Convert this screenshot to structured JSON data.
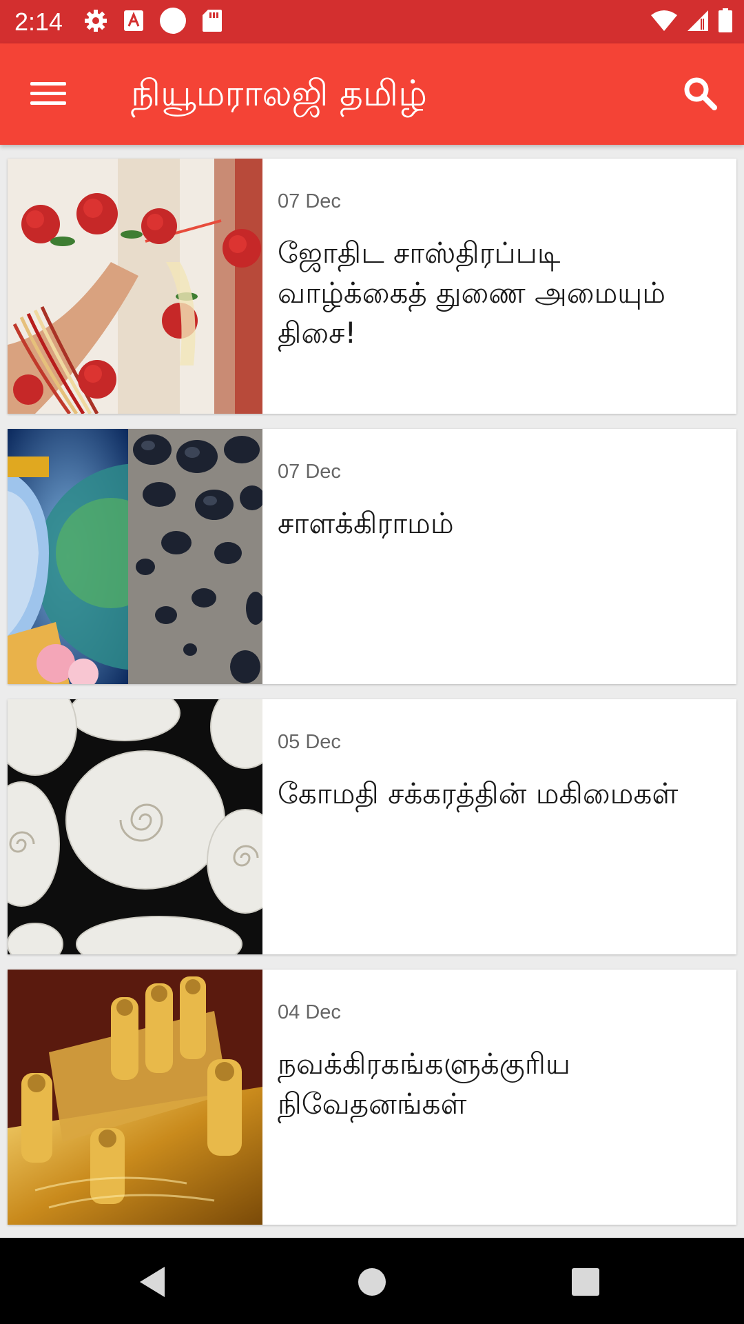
{
  "status_bar": {
    "time": "2:14",
    "icons": [
      "settings-icon",
      "app-notification-icon",
      "circle-notification-icon",
      "sd-card-icon",
      "wifi-icon",
      "signal-icon",
      "battery-icon"
    ]
  },
  "app_bar": {
    "title": "நியூமராலஜி தமிழ்",
    "menu_icon": "hamburger-menu-icon",
    "search_icon": "search-icon",
    "color": "#f44336",
    "status_color": "#d32f2f"
  },
  "articles": [
    {
      "date": "07 Dec",
      "title": "ஜோதிட சாஸ்திரப்படி வாழ்க்கைத் துணை அமையும் திசை!",
      "image": "wedding-garland-hands"
    },
    {
      "date": "07 Dec",
      "title": "சாளக்கிராமம்",
      "image": "vishnu-and-saligrama-stones"
    },
    {
      "date": "05 Dec",
      "title": "கோமதி சக்கரத்தின் மகிமைகள்",
      "image": "gomati-chakra-shells"
    },
    {
      "date": "04 Dec",
      "title": "நவக்கிரகங்களுக்குரிய நிவேதனங்கள்",
      "image": "golden-navagraha-idols"
    }
  ],
  "nav_bar": {
    "icons": [
      "back-icon",
      "home-icon",
      "recents-icon"
    ]
  }
}
